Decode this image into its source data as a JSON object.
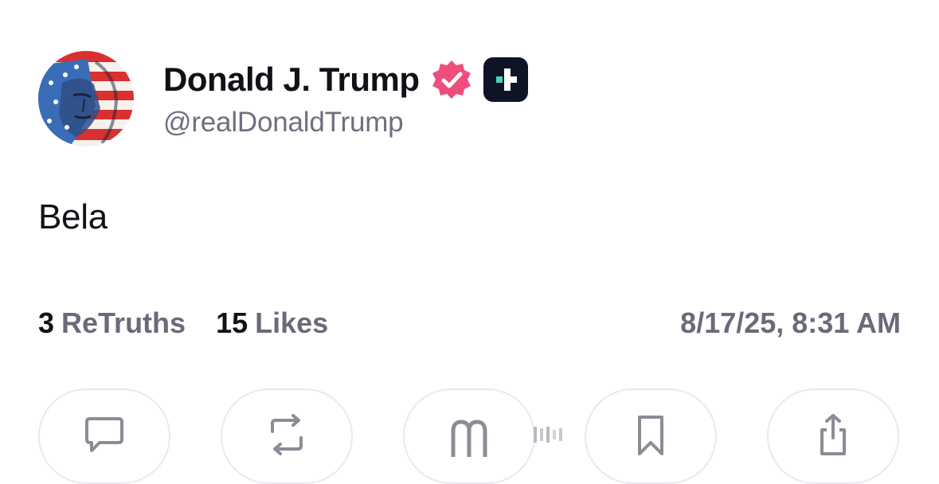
{
  "post": {
    "author": {
      "display_name": "Donald J. Trump",
      "handle": "@realDonaldTrump",
      "avatar_icon": "flag-portrait-avatar",
      "verified_icon": "verified-badge-icon",
      "plus_icon": "truth-plus-badge-icon"
    },
    "body_text": "Bela",
    "stats": {
      "retruths_count": "3",
      "retruths_label": "ReTruths",
      "likes_count": "15",
      "likes_label": "Likes"
    },
    "timestamp": "8/17/25, 8:31 AM"
  },
  "actions": [
    {
      "name": "reply",
      "icon": "comment-icon"
    },
    {
      "name": "retruth",
      "icon": "retruth-icon"
    },
    {
      "name": "like",
      "icon": "truth-logo-icon"
    },
    {
      "name": "bookmark",
      "icon": "bookmark-icon"
    },
    {
      "name": "share",
      "icon": "share-icon"
    }
  ],
  "colors": {
    "text_primary": "#111117",
    "text_secondary": "#6a6a7a",
    "verified_pink": "#ee4e7c",
    "plus_badge_bg": "#0e1326",
    "plus_accent": "#42d6b4",
    "action_border": "#e9e9ef",
    "icon_gray": "#8a8d96"
  }
}
